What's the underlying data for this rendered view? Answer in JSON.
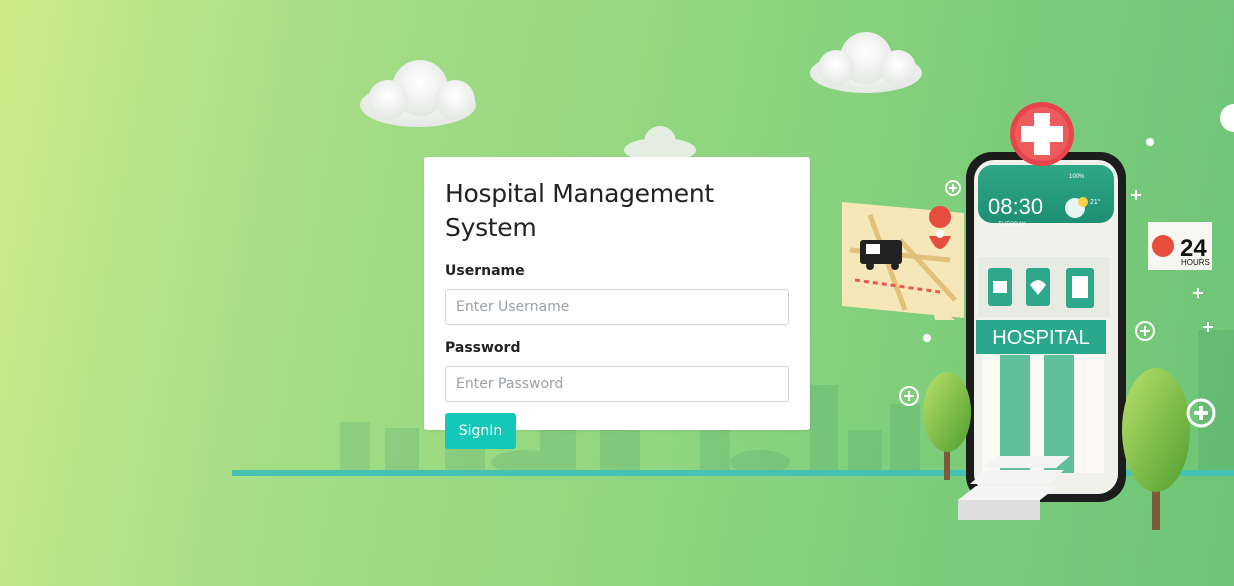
{
  "login": {
    "title": "Hospital Management System",
    "username_label": "Username",
    "username_placeholder": "Enter Username",
    "username_value": "",
    "password_label": "Password",
    "password_placeholder": "Enter Password",
    "password_value": "",
    "signin_label": "SignIn"
  },
  "illustration": {
    "phone_time": "08:30",
    "phone_day": "TUESDAY",
    "phone_battery": "100%",
    "phone_temp": "21°",
    "hospital_sign": "HOSPITAL",
    "hours_number": "24",
    "hours_label": "HOURS"
  },
  "colors": {
    "accent_button": "#14c8b9",
    "hospital_teal": "#2aa88e",
    "cross_red": "#e8454a",
    "ground_line": "#45c2b4"
  }
}
